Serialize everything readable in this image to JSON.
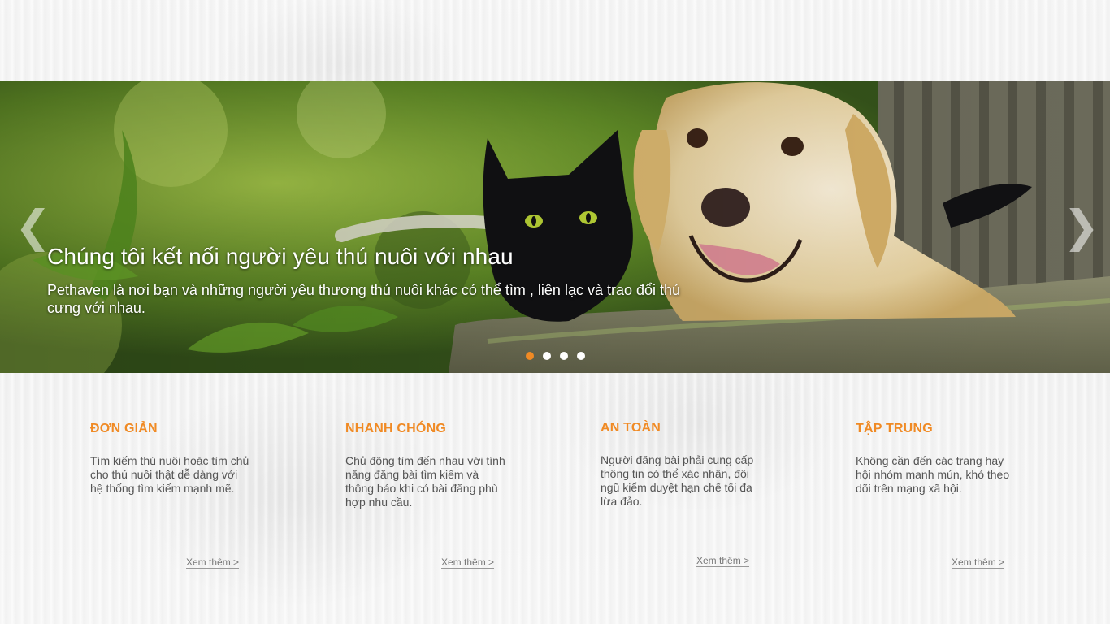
{
  "slider": {
    "title": "Chúng tôi kết nối người yêu thú nuôi với nhau",
    "description": "Pethaven là nơi bạn và những người yêu thương thú nuôi khác có thể tìm , liên lạc và trao đổi thú cưng với nhau.",
    "prev_icon": "❮",
    "next_icon": "❯",
    "active_slide": 1,
    "slide_count": 4,
    "active_dot_color": "#f08a24"
  },
  "features": [
    {
      "title": "ĐƠN GIẢN",
      "text": "Tím kiếm thú nuôi hoặc tìm chủ cho thú nuôi thật dễ dàng với hệ thống tìm kiếm mạnh mẽ.",
      "more": "Xem thêm >"
    },
    {
      "title": "NHANH CHÓNG",
      "text": "Chủ động tìm đến nhau với tính năng đăng bài tìm kiếm và thông báo khi có bài đăng phù hợp nhu cầu.",
      "more": "Xem thêm >"
    },
    {
      "title": "AN TOÀN",
      "text": "Người đăng bài phải cung cấp thông tin có thể xác nhận, đội ngũ kiểm duyệt hạn chế tối đa lừa đảo.",
      "more": "Xem thêm >"
    },
    {
      "title": "TẬP TRUNG",
      "text": "Không cần đến các trang hay hội nhóm manh mún, khó theo dõi trên mạng xã hội.",
      "more": "Xem thêm >"
    }
  ],
  "accent_color": "#f08a24"
}
